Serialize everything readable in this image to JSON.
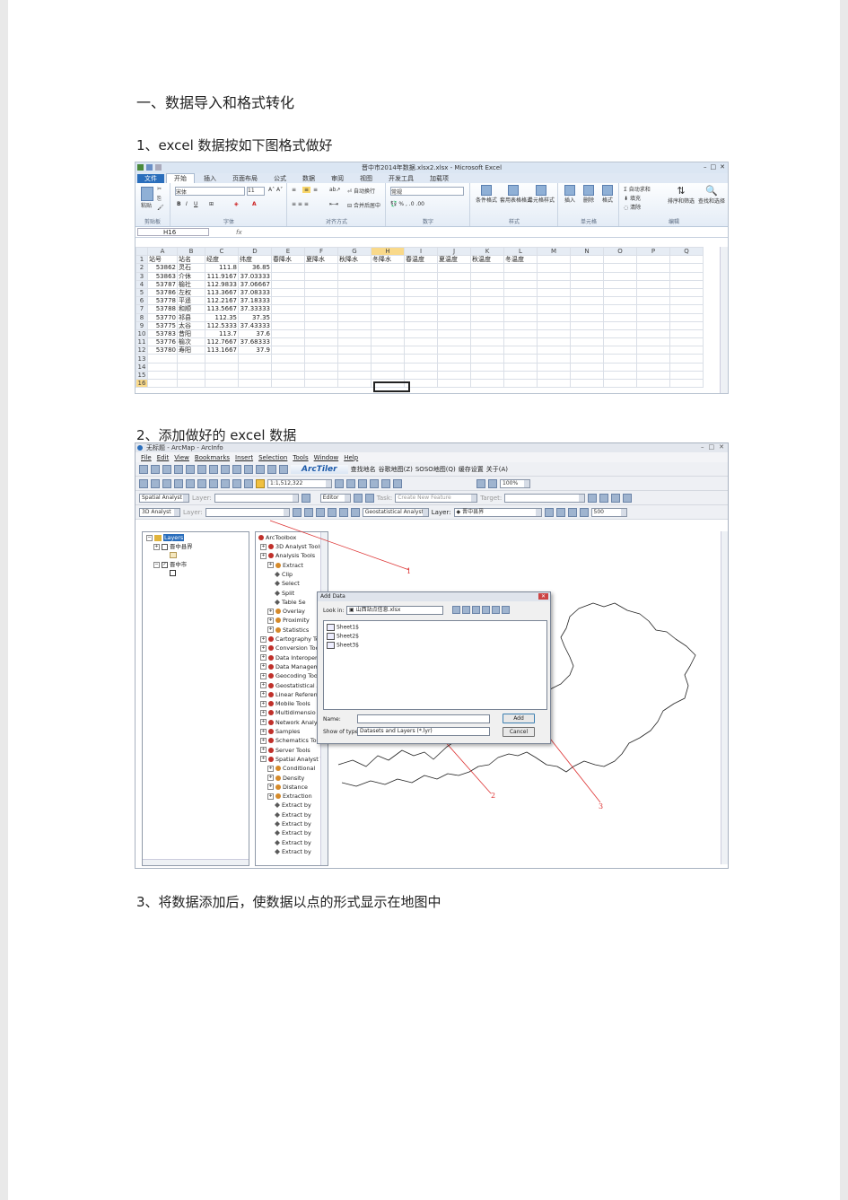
{
  "doc": {
    "heading": "一、数据导入和格式转化",
    "step1": "1、excel 数据按如下图格式做好",
    "step2": "2、添加做好的 excel 数据",
    "step3": "3、将数据添加后，使数据以点的形式显示在地图中"
  },
  "excel": {
    "window_title": "晋中市2014年数据.xlsx2.xlsx - Microsoft Excel",
    "tabs": [
      "文件",
      "开始",
      "插入",
      "页面布局",
      "公式",
      "数据",
      "审阅",
      "视图",
      "开发工具",
      "加载项"
    ],
    "active_tab": "开始",
    "font_name": "宋体",
    "font_size": "11",
    "number_format": "常规",
    "ribbon": {
      "paste": "粘贴",
      "wrap": "自动换行",
      "merge": "合并后居中",
      "cond_format": "条件格式",
      "table_format": "套用表格格式",
      "cell_style": "单元格样式",
      "insert": "插入",
      "delete": "删除",
      "format": "格式",
      "autosum": "Σ 自动求和",
      "fill": "填充",
      "clear": "清除",
      "sort": "排序和筛选",
      "find": "查找和选择"
    },
    "group_labels": [
      "剪贴板",
      "字体",
      "对齐方式",
      "数字",
      "样式",
      "单元格",
      "编辑"
    ],
    "name_box": "H16",
    "fx": "fx",
    "columns": [
      "A",
      "B",
      "C",
      "D",
      "E",
      "F",
      "G",
      "H",
      "I",
      "J",
      "K",
      "L",
      "M",
      "N",
      "O",
      "P",
      "Q"
    ],
    "selected_column": "H",
    "header_row": [
      "站号",
      "站名",
      "经度",
      "纬度",
      "春降水",
      "夏降水",
      "秋降水",
      "冬降水",
      "春温度",
      "夏温度",
      "秋温度",
      "冬温度"
    ],
    "rows": [
      [
        "53862",
        "灵石",
        "111.8",
        "36.85"
      ],
      [
        "53863",
        "介休",
        "111.9167",
        "37.03333"
      ],
      [
        "53787",
        "榆社",
        "112.9833",
        "37.06667"
      ],
      [
        "53786",
        "左权",
        "113.3667",
        "37.08333"
      ],
      [
        "53778",
        "平遥",
        "112.2167",
        "37.18333"
      ],
      [
        "53788",
        "和顺",
        "113.5667",
        "37.33333"
      ],
      [
        "53770",
        "祁县",
        "112.35",
        "37.35"
      ],
      [
        "53775",
        "太谷",
        "112.5333",
        "37.43333"
      ],
      [
        "53783",
        "昔阳",
        "113.7",
        "37.6"
      ],
      [
        "53776",
        "榆次",
        "112.7667",
        "37.68333"
      ],
      [
        "53780",
        "寿阳",
        "113.1667",
        "37.9"
      ]
    ],
    "row_numbers": [
      "1",
      "2",
      "3",
      "4",
      "5",
      "6",
      "7",
      "8",
      "9",
      "10",
      "11",
      "12",
      "13",
      "14",
      "15",
      "16"
    ]
  },
  "arcmap": {
    "window_title": "无标题 - ArcMap - ArcInfo",
    "menus": [
      "File",
      "Edit",
      "View",
      "Bookmarks",
      "Insert",
      "Selection",
      "Tools",
      "Window",
      "Help"
    ],
    "arctiler": "ArcTiler",
    "cn_toolbar": [
      "查找地名",
      "谷歌地图(Z)",
      "SOSO地图(Q)",
      "缓存设置",
      "关于(A)"
    ],
    "scale": "1:1,512,322",
    "zoom": "100%",
    "spatial_analyst": "Spatial Analyst",
    "layer_label": "Layer:",
    "editor": "Editor",
    "task_label": "Task:",
    "task_value": "Create New Feature",
    "target_label": "Target:",
    "analyst_3d": "3D Analyst",
    "geostat": "Geostatistical Analyst",
    "layer_value": "晋中县界",
    "scale_box": "500",
    "toc": {
      "root": "Layers",
      "layer1": "晋中县界",
      "layer2": "晋中市"
    },
    "toolbox": {
      "root": "ArcToolbox",
      "items": [
        {
          "label": "3D Analyst Tools",
          "level": 1,
          "kind": "box"
        },
        {
          "label": "Analysis Tools",
          "level": 1,
          "kind": "box"
        },
        {
          "label": "Extract",
          "level": 2,
          "kind": "set"
        },
        {
          "label": "Clip",
          "level": 3,
          "kind": "tool"
        },
        {
          "label": "Select",
          "level": 3,
          "kind": "tool"
        },
        {
          "label": "Split",
          "level": 3,
          "kind": "tool"
        },
        {
          "label": "Table Se",
          "level": 3,
          "kind": "tool"
        },
        {
          "label": "Overlay",
          "level": 2,
          "kind": "set"
        },
        {
          "label": "Proximity",
          "level": 2,
          "kind": "set"
        },
        {
          "label": "Statistics",
          "level": 2,
          "kind": "set"
        },
        {
          "label": "Cartography To",
          "level": 1,
          "kind": "box"
        },
        {
          "label": "Conversion Too",
          "level": 1,
          "kind": "box"
        },
        {
          "label": "Data Interopera",
          "level": 1,
          "kind": "box"
        },
        {
          "label": "Data Managem",
          "level": 1,
          "kind": "box"
        },
        {
          "label": "Geocoding Too",
          "level": 1,
          "kind": "box"
        },
        {
          "label": "Geostatistical A",
          "level": 1,
          "kind": "box"
        },
        {
          "label": "Linear Referenc",
          "level": 1,
          "kind": "box"
        },
        {
          "label": "Mobile Tools",
          "level": 1,
          "kind": "box"
        },
        {
          "label": "Multidimensio",
          "level": 1,
          "kind": "box"
        },
        {
          "label": "Network Analys",
          "level": 1,
          "kind": "box"
        },
        {
          "label": "Samples",
          "level": 1,
          "kind": "box"
        },
        {
          "label": "Schematics Too",
          "level": 1,
          "kind": "box"
        },
        {
          "label": "Server Tools",
          "level": 1,
          "kind": "box"
        },
        {
          "label": "Spatial Analyst Tc",
          "level": 1,
          "kind": "box"
        },
        {
          "label": "Conditional",
          "level": 2,
          "kind": "set"
        },
        {
          "label": "Density",
          "level": 2,
          "kind": "set"
        },
        {
          "label": "Distance",
          "level": 2,
          "kind": "set"
        },
        {
          "label": "Extraction",
          "level": 2,
          "kind": "set"
        },
        {
          "label": "Extract by",
          "level": 3,
          "kind": "tool"
        },
        {
          "label": "Extract by",
          "level": 3,
          "kind": "tool"
        },
        {
          "label": "Extract by",
          "level": 3,
          "kind": "tool"
        },
        {
          "label": "Extract by",
          "level": 3,
          "kind": "tool"
        },
        {
          "label": "Extract by",
          "level": 3,
          "kind": "tool"
        },
        {
          "label": "Extract by",
          "level": 3,
          "kind": "tool"
        }
      ]
    },
    "dialog": {
      "title": "Add Data",
      "look_in_label": "Look in:",
      "look_in_value": "山西站点信息.xlsx",
      "sheets": [
        "Sheet1$",
        "Sheet2$",
        "Sheet3$"
      ],
      "name_label": "Name:",
      "name_value": "",
      "type_label": "Show of type:",
      "type_value": "Datasets and Layers (*.lyr)",
      "add_button": "Add",
      "cancel_button": "Cancel"
    },
    "annotations": [
      "1",
      "2",
      "3"
    ],
    "annotation_color": "#dd3333"
  }
}
